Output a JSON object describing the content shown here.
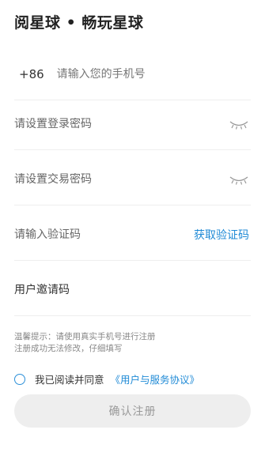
{
  "header": {
    "title": "阅星球 • 畅玩星球"
  },
  "form": {
    "phone": {
      "country_code": "+86",
      "placeholder": "请输入您的手机号"
    },
    "login_password": {
      "placeholder": "请设置登录密码",
      "toggle_icon": "eye-closed-icon"
    },
    "trade_password": {
      "placeholder": "请设置交易密码",
      "toggle_icon": "eye-closed-icon"
    },
    "verification_code": {
      "placeholder": "请输入验证码",
      "get_code_label": "获取验证码"
    },
    "invite_code": {
      "placeholder": "用户邀请码"
    }
  },
  "hint": {
    "line1": "温馨提示：请使用真实手机号进行注册",
    "line2": "注册成功无法修改，仔细填写"
  },
  "agreement": {
    "prefix": "我已阅读并同意",
    "link": "《用户与服务协议》"
  },
  "submit": {
    "label": "确认注册"
  },
  "colors": {
    "accent": "#1f8ad6",
    "button_bg": "#eeeeee",
    "button_text": "#999999",
    "divider": "#eeeeee"
  }
}
